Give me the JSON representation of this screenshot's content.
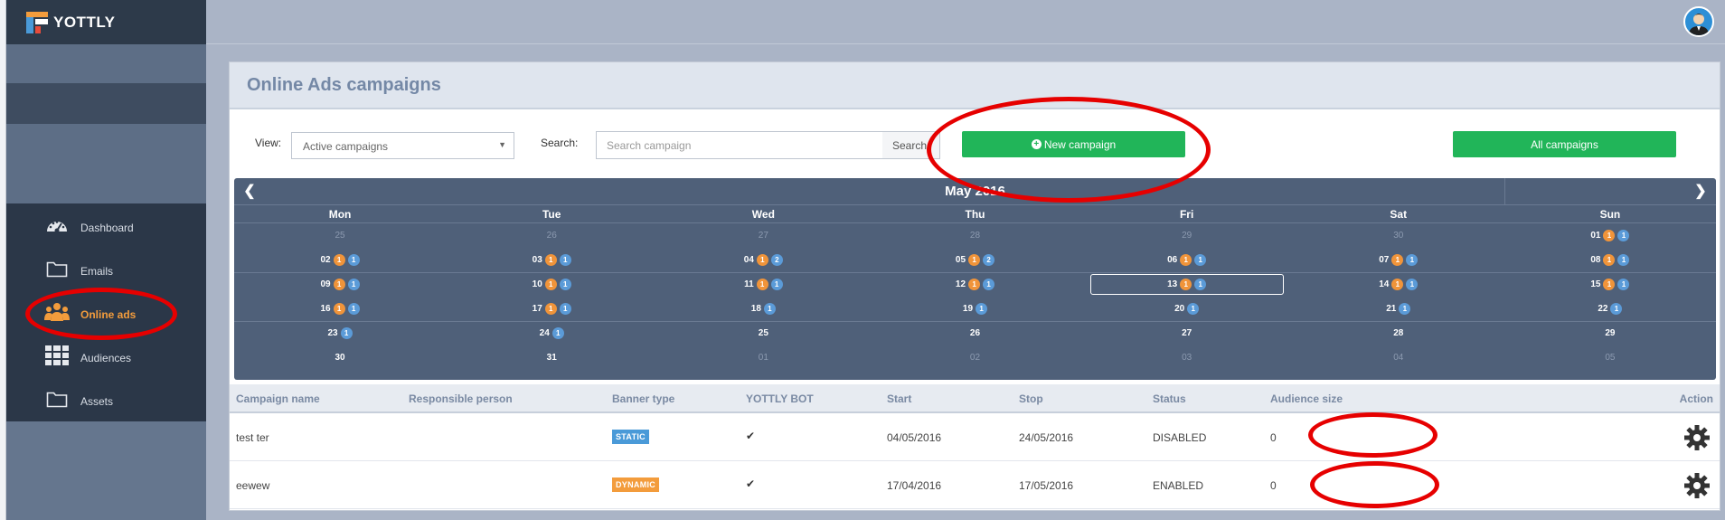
{
  "app": {
    "name": "YOTTLY"
  },
  "sidebar": {
    "items": [
      {
        "label": "Dashboard",
        "icon": "dashboard-icon"
      },
      {
        "label": "Emails",
        "icon": "folder-icon"
      },
      {
        "label": "Online ads",
        "icon": "users-icon",
        "active": true
      },
      {
        "label": "Audiences",
        "icon": "grid-icon"
      },
      {
        "label": "Assets",
        "icon": "folder-icon"
      }
    ]
  },
  "page": {
    "title": "Online Ads campaigns"
  },
  "toolbar": {
    "view_label": "View:",
    "view_selected": "Active campaigns",
    "search_label": "Search:",
    "search_placeholder": "Search campaign",
    "search_button": "Search",
    "new_campaign_label": "New campaign",
    "all_campaigns_label": "All campaigns"
  },
  "calendar": {
    "month": "May 2016",
    "weekdays": [
      "Mon",
      "Tue",
      "Wed",
      "Thu",
      "Fri",
      "Sat",
      "Sun"
    ],
    "weeks": [
      [
        {
          "d": "25",
          "m": true
        },
        {
          "d": "26",
          "m": true
        },
        {
          "d": "27",
          "m": true
        },
        {
          "d": "28",
          "m": true
        },
        {
          "d": "29",
          "m": true
        },
        {
          "d": "30",
          "m": true
        },
        {
          "d": "01",
          "o": "1",
          "b": "1"
        }
      ],
      [
        {
          "d": "02",
          "o": "1",
          "b": "1"
        },
        {
          "d": "03",
          "o": "1",
          "b": "1"
        },
        {
          "d": "04",
          "o": "1",
          "b": "2"
        },
        {
          "d": "05",
          "o": "1",
          "b": "2"
        },
        {
          "d": "06",
          "o": "1",
          "b": "1"
        },
        {
          "d": "07",
          "o": "1",
          "b": "1"
        },
        {
          "d": "08",
          "o": "1",
          "b": "1"
        }
      ],
      [
        {
          "d": "09",
          "o": "1",
          "b": "1"
        },
        {
          "d": "10",
          "o": "1",
          "b": "1"
        },
        {
          "d": "11",
          "o": "1",
          "b": "1"
        },
        {
          "d": "12",
          "o": "1",
          "b": "1"
        },
        {
          "d": "13",
          "o": "1",
          "b": "1",
          "today": true
        },
        {
          "d": "14",
          "o": "1",
          "b": "1"
        },
        {
          "d": "15",
          "o": "1",
          "b": "1"
        }
      ],
      [
        {
          "d": "16",
          "o": "1",
          "b": "1"
        },
        {
          "d": "17",
          "o": "1",
          "b": "1"
        },
        {
          "d": "18",
          "b": "1"
        },
        {
          "d": "19",
          "b": "1"
        },
        {
          "d": "20",
          "b": "1"
        },
        {
          "d": "21",
          "b": "1"
        },
        {
          "d": "22",
          "b": "1"
        }
      ],
      [
        {
          "d": "23",
          "b": "1"
        },
        {
          "d": "24",
          "b": "1"
        },
        {
          "d": "25"
        },
        {
          "d": "26"
        },
        {
          "d": "27"
        },
        {
          "d": "28"
        },
        {
          "d": "29"
        }
      ],
      [
        {
          "d": "30"
        },
        {
          "d": "31"
        },
        {
          "d": "01",
          "m": true
        },
        {
          "d": "02",
          "m": true
        },
        {
          "d": "03",
          "m": true
        },
        {
          "d": "04",
          "m": true
        },
        {
          "d": "05",
          "m": true
        }
      ]
    ]
  },
  "table": {
    "columns": [
      "Campaign name",
      "Responsible person",
      "Banner type",
      "YOTTLY BOT",
      "Start",
      "Stop",
      "Status",
      "Audience size",
      "Action"
    ],
    "rows": [
      {
        "name": "test ter",
        "person": "",
        "banner": "STATIC",
        "bot": "✔",
        "start": "04/05/2016",
        "stop": "24/05/2016",
        "status": "DISABLED",
        "audience": "0"
      },
      {
        "name": "eewew",
        "person": "",
        "banner": "DYNAMIC",
        "bot": "✔",
        "start": "17/04/2016",
        "stop": "17/05/2016",
        "status": "ENABLED",
        "audience": "0"
      }
    ]
  },
  "colors": {
    "accent_green": "#21b559",
    "accent_orange": "#f39c3c",
    "annotation_red": "#e60000",
    "sidebar_dark": "#2b3748",
    "calendar_bg": "#4f6079"
  }
}
